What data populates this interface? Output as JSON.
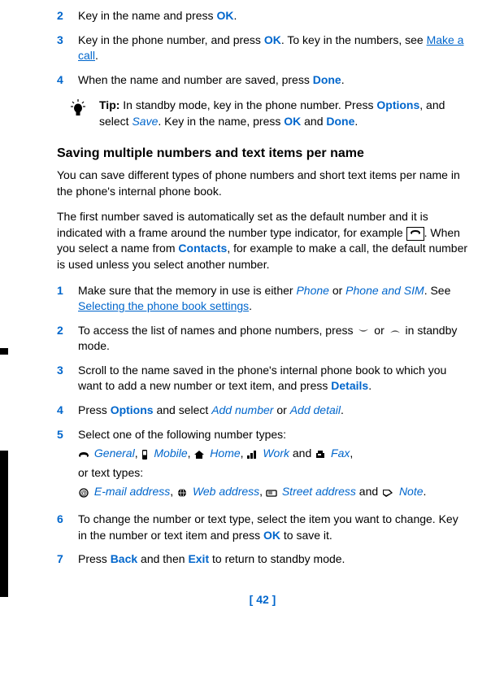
{
  "steps_top": [
    {
      "num": "2",
      "parts": [
        {
          "t": "Key in the name and press "
        },
        {
          "t": "OK",
          "cls": "link-blue"
        },
        {
          "t": "."
        }
      ]
    },
    {
      "num": "3",
      "parts": [
        {
          "t": "Key in the phone number, and press "
        },
        {
          "t": "OK",
          "cls": "link-blue"
        },
        {
          "t": ". To key in the numbers, see "
        },
        {
          "t": "Make a call",
          "cls": "link-blue-u"
        },
        {
          "t": "."
        }
      ]
    },
    {
      "num": "4",
      "parts": [
        {
          "t": "When the name and number are saved, press "
        },
        {
          "t": "Done",
          "cls": "link-blue"
        },
        {
          "t": "."
        }
      ]
    }
  ],
  "tip": {
    "label": "Tip:",
    "parts": [
      {
        "t": " In standby mode, key in the phone number. Press "
      },
      {
        "t": "Options",
        "cls": "link-blue"
      },
      {
        "t": ", and select "
      },
      {
        "t": "Save",
        "cls": "ital-blue"
      },
      {
        "t": ". Key in the name, press "
      },
      {
        "t": "OK",
        "cls": "link-blue"
      },
      {
        "t": " and "
      },
      {
        "t": "Done",
        "cls": "link-blue"
      },
      {
        "t": "."
      }
    ]
  },
  "section_heading": "Saving multiple numbers and text items per name",
  "para1": "You can save different types of phone numbers and short text items per name in the phone's internal phone book.",
  "para2_parts": [
    {
      "t": "The first number saved is automatically set as the default number and it is indicated with a frame around the number type indicator, for example "
    },
    {
      "icon": "framed-phone"
    },
    {
      "t": ". When you select a name from "
    },
    {
      "t": "Contacts",
      "cls": "link-blue"
    },
    {
      "t": ", for example to make a call, the default number is used unless you select another number."
    }
  ],
  "steps_mid": [
    {
      "num": "1",
      "parts": [
        {
          "t": "Make sure that the memory in use is either "
        },
        {
          "t": "Phone",
          "cls": "ital-blue"
        },
        {
          "t": " or "
        },
        {
          "t": "Phone and SIM",
          "cls": "ital-blue"
        },
        {
          "t": ". See "
        },
        {
          "t": "Selecting the phone book settings",
          "cls": "link-blue-u"
        },
        {
          "t": "."
        }
      ]
    },
    {
      "num": "2",
      "parts": [
        {
          "t": "To access the list of names and phone numbers, press "
        },
        {
          "icon": "arrow-down"
        },
        {
          "t": " or "
        },
        {
          "icon": "arrow-up"
        },
        {
          "t": " in standby mode."
        }
      ]
    },
    {
      "num": "3",
      "parts": [
        {
          "t": "Scroll to the name saved in the phone's internal phone book to which you want to add a new number or text item, and press "
        },
        {
          "t": "Details",
          "cls": "link-blue"
        },
        {
          "t": "."
        }
      ]
    },
    {
      "num": "4",
      "parts": [
        {
          "t": "Press "
        },
        {
          "t": "Options",
          "cls": "link-blue"
        },
        {
          "t": " and select "
        },
        {
          "t": "Add number",
          "cls": "ital-blue"
        },
        {
          "t": " or "
        },
        {
          "t": "Add detail",
          "cls": "ital-blue"
        },
        {
          "t": "."
        }
      ]
    }
  ],
  "step5": {
    "num": "5",
    "intro": "Select one of the following number types:",
    "num_types": [
      {
        "icon": "phone",
        "label": "General"
      },
      {
        "icon": "mobile",
        "label": "Mobile"
      },
      {
        "icon": "home",
        "label": "Home"
      },
      {
        "icon": "work",
        "label": "Work"
      },
      {
        "icon": "fax",
        "label": "Fax"
      }
    ],
    "or_text": "or text types:",
    "text_types": [
      {
        "icon": "email",
        "label": "E-mail address"
      },
      {
        "icon": "web",
        "label": "Web address"
      },
      {
        "icon": "street",
        "label": "Street address"
      },
      {
        "icon": "note",
        "label": "Note"
      }
    ]
  },
  "step6": {
    "num": "6",
    "parts": [
      {
        "t": "To change the number or text type, select the item you want to change.  Key in the number or text item and press "
      },
      {
        "t": "OK",
        "cls": "link-blue"
      },
      {
        "t": " to save it."
      }
    ]
  },
  "step7": {
    "num": "7",
    "parts": [
      {
        "t": "Press "
      },
      {
        "t": "Back",
        "cls": "link-blue"
      },
      {
        "t": " and then "
      },
      {
        "t": "Exit",
        "cls": "link-blue"
      },
      {
        "t": " to return to standby mode."
      }
    ]
  },
  "page_number": "[ 42 ]",
  "joiners": {
    "comma": ", ",
    "and": " and "
  }
}
